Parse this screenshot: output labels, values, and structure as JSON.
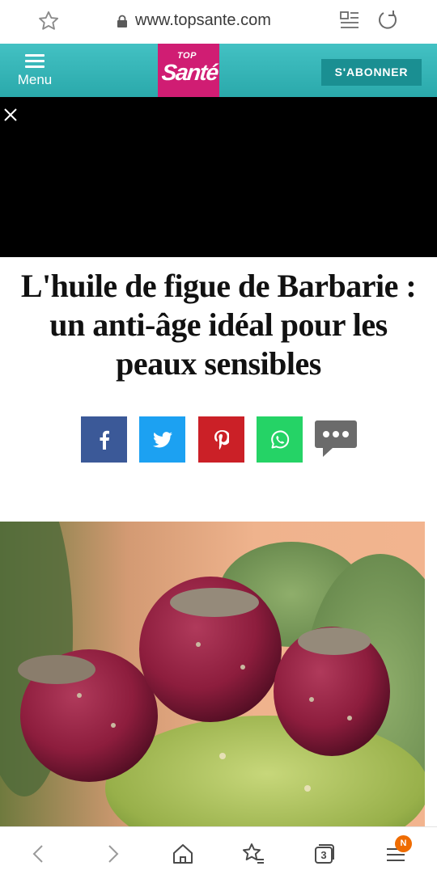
{
  "browser": {
    "url": "www.topsante.com",
    "tab_count": "3",
    "notification_badge": "N"
  },
  "header": {
    "menu_label": "Menu",
    "logo_top": "TOP",
    "logo_main": "Santé",
    "subscribe_label": "S'ABONNER"
  },
  "article": {
    "title_line1": "L'huile de figue de Barbarie :",
    "title_line2": "un anti-âge idéal pour les",
    "title_line3": "peaux sensibles"
  },
  "share_buttons": [
    "facebook-icon",
    "twitter-icon",
    "pinterest-icon",
    "whatsapp-icon",
    "comments-icon"
  ],
  "colors": {
    "header_teal": "#2aa9ab",
    "brand_pink": "#d01d73",
    "subscribe_bg": "#1a8f92",
    "facebook": "#3b5998",
    "twitter": "#1ca1f2",
    "pinterest": "#cb2027",
    "whatsapp": "#25d366",
    "badge_orange": "#ef6c00"
  }
}
